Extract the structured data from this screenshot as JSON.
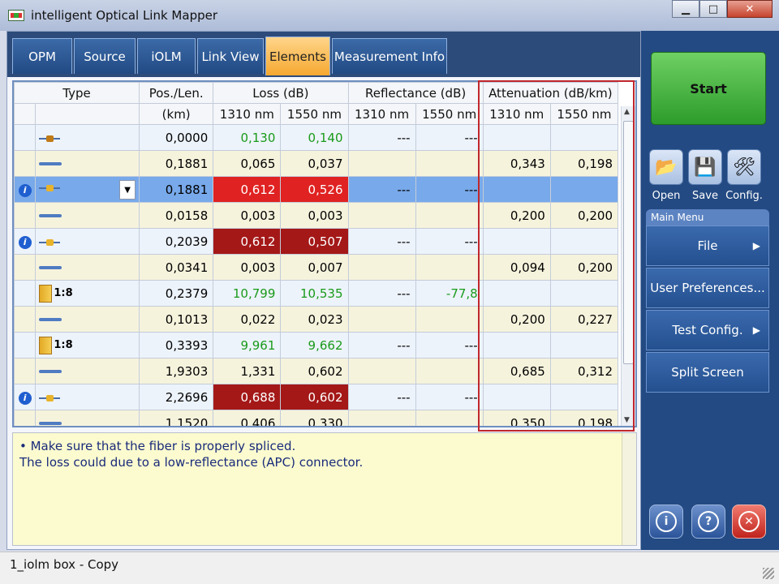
{
  "window": {
    "title": "intelligent Optical Link Mapper",
    "minimize": "▁",
    "maximize": "□",
    "close": "✕"
  },
  "tabs": [
    {
      "label": "OPM"
    },
    {
      "label": "Source"
    },
    {
      "label": "iOLM"
    },
    {
      "label": "Link View"
    },
    {
      "label": "Elements"
    },
    {
      "label": "Measurement Info"
    }
  ],
  "active_tab": "Elements",
  "table": {
    "headers": {
      "type": "Type",
      "pos": "Pos./Len.",
      "loss": "Loss (dB)",
      "refl": "Reflectance (dB)",
      "atten": "Attenuation (dB/km)",
      "unit_km": "(km)",
      "nm1310": "1310 nm",
      "nm1550": "1550 nm"
    },
    "rows": [
      {
        "info": "",
        "icon": "connector-icon",
        "label": "",
        "pos": "0,0000",
        "loss1310": "0,130",
        "loss1550": "0,140",
        "refl1310": "---",
        "refl1550": "---",
        "att1310": "",
        "att1550": "",
        "style": "odd",
        "loss_color": "green"
      },
      {
        "info": "",
        "icon": "fiber-icon",
        "label": "",
        "pos": "0,1881",
        "loss1310": "0,065",
        "loss1550": "0,037",
        "refl1310": "",
        "refl1550": "",
        "att1310": "0,343",
        "att1550": "0,198",
        "style": "even",
        "loss_color": ""
      },
      {
        "info": "i",
        "icon": "connector-icon",
        "label": "",
        "pos": "0,1881",
        "loss1310": "0,612",
        "loss1550": "0,526",
        "refl1310": "---",
        "refl1550": "---",
        "att1310": "",
        "att1550": "",
        "style": "sel",
        "loss_color": "redbright"
      },
      {
        "info": "",
        "icon": "fiber-icon",
        "label": "",
        "pos": "0,0158",
        "loss1310": "0,003",
        "loss1550": "0,003",
        "refl1310": "",
        "refl1550": "",
        "att1310": "0,200",
        "att1550": "0,200",
        "style": "even",
        "loss_color": ""
      },
      {
        "info": "i",
        "icon": "connector-icon",
        "label": "",
        "pos": "0,2039",
        "loss1310": "0,612",
        "loss1550": "0,507",
        "refl1310": "---",
        "refl1550": "---",
        "att1310": "",
        "att1550": "",
        "style": "odd",
        "loss_color": "reddark"
      },
      {
        "info": "",
        "icon": "fiber-icon",
        "label": "",
        "pos": "0,0341",
        "loss1310": "0,003",
        "loss1550": "0,007",
        "refl1310": "",
        "refl1550": "",
        "att1310": "0,094",
        "att1550": "0,200",
        "style": "even",
        "loss_color": ""
      },
      {
        "info": "",
        "icon": "splitter-icon",
        "label": "1:8",
        "pos": "0,2379",
        "loss1310": "10,799",
        "loss1550": "10,535",
        "refl1310": "---",
        "refl1550": "-77,8",
        "att1310": "",
        "att1550": "",
        "style": "odd",
        "loss_color": "green"
      },
      {
        "info": "",
        "icon": "fiber-icon",
        "label": "",
        "pos": "0,1013",
        "loss1310": "0,022",
        "loss1550": "0,023",
        "refl1310": "",
        "refl1550": "",
        "att1310": "0,200",
        "att1550": "0,227",
        "style": "even",
        "loss_color": ""
      },
      {
        "info": "",
        "icon": "splitter-icon",
        "label": "1:8",
        "pos": "0,3393",
        "loss1310": "9,961",
        "loss1550": "9,662",
        "refl1310": "---",
        "refl1550": "---",
        "att1310": "",
        "att1550": "",
        "style": "odd",
        "loss_color": "green"
      },
      {
        "info": "",
        "icon": "fiber-icon",
        "label": "",
        "pos": "1,9303",
        "loss1310": "1,331",
        "loss1550": "0,602",
        "refl1310": "",
        "refl1550": "",
        "att1310": "0,685",
        "att1550": "0,312",
        "style": "even",
        "loss_color": ""
      },
      {
        "info": "i",
        "icon": "connector-icon",
        "label": "",
        "pos": "2,2696",
        "loss1310": "0,688",
        "loss1550": "0,602",
        "refl1310": "---",
        "refl1550": "---",
        "att1310": "",
        "att1550": "",
        "style": "odd",
        "loss_color": "reddark"
      },
      {
        "info": "",
        "icon": "fiber-icon",
        "label": "",
        "pos": "1,1520",
        "loss1310": "0,406",
        "loss1550": "0,330",
        "refl1310": "",
        "refl1550": "",
        "att1310": "0,350",
        "att1550": "0,198",
        "style": "even",
        "loss_color": ""
      }
    ]
  },
  "message": {
    "line1": "• Make sure that the fiber is properly spliced.",
    "line2": "The loss could due to a low-reflectance (APC) connector."
  },
  "sidebar": {
    "start": "Start",
    "open": "Open",
    "save": "Save",
    "config": "Config.",
    "main_menu": "Main Menu",
    "menu": [
      {
        "label": "File",
        "arrow": "▶"
      },
      {
        "label": "User Preferences...",
        "arrow": ""
      },
      {
        "label": "Test Config.",
        "arrow": "▶"
      },
      {
        "label": "Split Screen",
        "arrow": ""
      }
    ]
  },
  "status": {
    "text": "1_iolm box - Copy"
  },
  "colors": {
    "accent_tab": "#f6a830",
    "selected_row": "#78a9ea",
    "fail_bright": "#e02222",
    "fail_dark": "#a41818",
    "pass_green": "#1a9a1a",
    "highlight": "#c0272d"
  }
}
